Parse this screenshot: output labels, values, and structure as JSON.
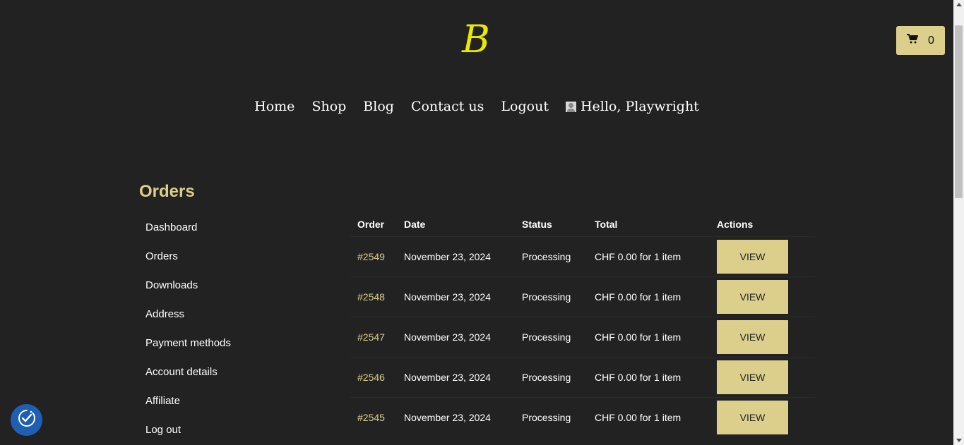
{
  "brand": {
    "logo_text": "B",
    "accent": "#dccf8c",
    "logo_color": "#e8e800"
  },
  "cart": {
    "count": "0",
    "icon": "cart-icon"
  },
  "nav": {
    "items": [
      "Home",
      "Shop",
      "Blog",
      "Contact us",
      "Logout"
    ],
    "greeting": "Hello, Playwright"
  },
  "page": {
    "title": "Orders"
  },
  "account_nav": [
    "Dashboard",
    "Orders",
    "Downloads",
    "Address",
    "Payment methods",
    "Account details",
    "Affiliate",
    "Log out"
  ],
  "orders": {
    "headers": [
      "Order",
      "Date",
      "Status",
      "Total",
      "Actions"
    ],
    "rows": [
      {
        "order": "#2549",
        "date": "November 23, 2024",
        "status": "Processing",
        "total": "CHF 0.00 for 1 item",
        "action": "VIEW"
      },
      {
        "order": "#2548",
        "date": "November 23, 2024",
        "status": "Processing",
        "total": "CHF 0.00 for 1 item",
        "action": "VIEW"
      },
      {
        "order": "#2547",
        "date": "November 23, 2024",
        "status": "Processing",
        "total": "CHF 0.00 for 1 item",
        "action": "VIEW"
      },
      {
        "order": "#2546",
        "date": "November 23, 2024",
        "status": "Processing",
        "total": "CHF 0.00 for 1 item",
        "action": "VIEW"
      },
      {
        "order": "#2545",
        "date": "November 23, 2024",
        "status": "Processing",
        "total": "CHF 0.00 for 1 item",
        "action": "VIEW"
      }
    ]
  },
  "consent_badge": {
    "icon": "cookie-consent-icon"
  }
}
